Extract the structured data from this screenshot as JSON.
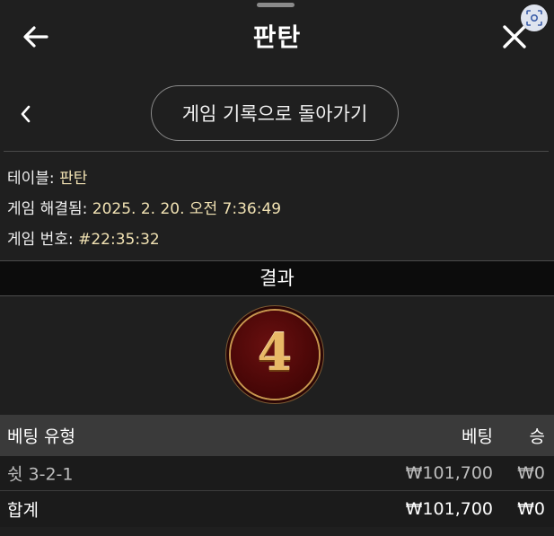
{
  "header": {
    "title": "판탄",
    "back_icon": "arrow-left-icon",
    "close_icon": "close-icon",
    "scan_icon": "scan-icon"
  },
  "nav": {
    "back_icon": "chevron-left-icon",
    "history_button": "게임 기록으로 돌아가기"
  },
  "info": {
    "table_label": "테이블: ",
    "table_value": "판탄",
    "resolved_label": "게임 해결됨: ",
    "resolved_value": "2025. 2. 20. 오전 7:36:49",
    "game_no_label": "게임 번호: ",
    "game_no_value": "#22:35:32"
  },
  "result": {
    "heading": "결과",
    "number": "4"
  },
  "table": {
    "headers": {
      "type": "베팅 유형",
      "bet": "베팅",
      "win": "승"
    },
    "rows": [
      {
        "type": "쉿 3-2-1",
        "bet": "₩101,700",
        "win": "₩0"
      }
    ],
    "total": {
      "label": "합계",
      "bet": "₩101,700",
      "win": "₩0"
    }
  },
  "colors": {
    "background": "#1f1f1f",
    "accent_text": "#f1e2b3",
    "ball_red": "#4a0707",
    "ball_gold": "#e8b866",
    "table_header_bg": "#3a3a3a"
  }
}
